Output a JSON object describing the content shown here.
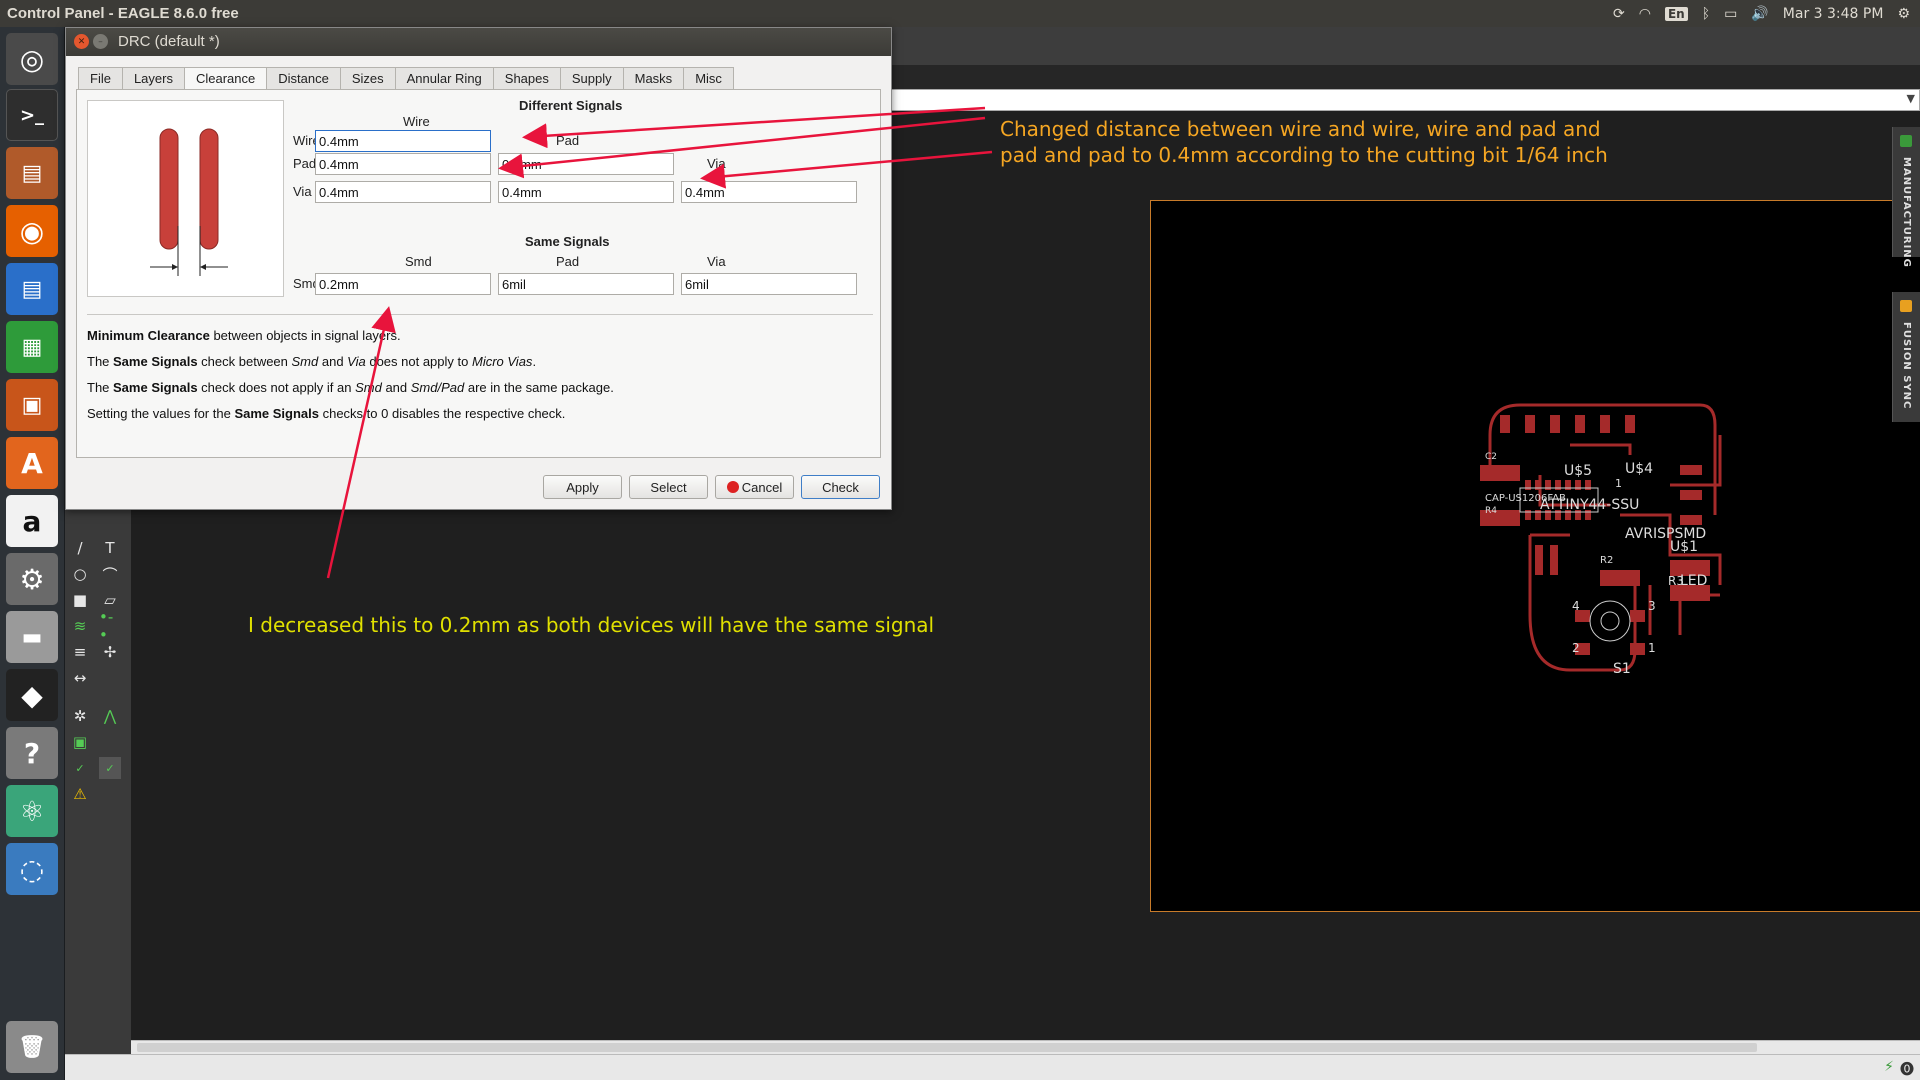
{
  "topbar": {
    "title": "Control Panel - EAGLE 8.6.0 free",
    "language": "En",
    "datetime": "Mar 3  3:48 PM"
  },
  "launcher": {
    "items": [
      "ubuntu-dash-icon",
      "terminal-icon",
      "files-icon",
      "firefox-icon",
      "writer-icon",
      "calc-icon",
      "impress-icon",
      "software-center-icon",
      "amazon-icon",
      "system-settings-icon",
      "disk-icon",
      "inkscape-icon",
      "help-icon",
      "atom-icon",
      "fusion-icon",
      "trash-icon"
    ]
  },
  "dialog": {
    "title": "DRC (default *)",
    "tabs": [
      "File",
      "Layers",
      "Clearance",
      "Distance",
      "Sizes",
      "Annular Ring",
      "Shapes",
      "Supply",
      "Masks",
      "Misc"
    ],
    "active_tab": "Clearance",
    "different_signals": {
      "title": "Different Signals",
      "col_wire": "Wire",
      "col_pad": "Pad",
      "col_via": "Via",
      "row_wire": "Wire",
      "row_pad": "Pad",
      "row_via": "Via",
      "wire_wire": "0.4mm",
      "pad_wire": "0.4mm",
      "pad_pad": "0.4mm",
      "via_wire": "0.4mm",
      "via_pad": "0.4mm",
      "via_via": "0.4mm"
    },
    "same_signals": {
      "title": "Same Signals",
      "col_smd": "Smd",
      "col_pad": "Pad",
      "col_via": "Via",
      "row_smd": "Smd",
      "smd_smd": "0.2mm",
      "smd_pad": "6mil",
      "smd_via": "6mil"
    },
    "descriptions": {
      "line1_bold": "Minimum Clearance",
      "line1_rest": " between objects in signal layers.",
      "line2_a": "The ",
      "line2_b": "Same Signals",
      "line2_c": " check between ",
      "line2_d": "Smd",
      "line2_e": " and ",
      "line2_f": "Via",
      "line2_g": " does not apply to ",
      "line2_h": "Micro Vias",
      "line2_i": ".",
      "line3_a": "The ",
      "line3_b": "Same Signals",
      "line3_c": " check does not apply if an ",
      "line3_d": "Smd",
      "line3_e": " and ",
      "line3_f": "Smd/Pad",
      "line3_g": " are in the same package.",
      "line4_a": "Setting the values for the ",
      "line4_b": "Same Signals",
      "line4_c": " checks to 0 disables the respective check."
    },
    "buttons": {
      "apply": "Apply",
      "select": "Select",
      "cancel": "Cancel",
      "check": "Check"
    }
  },
  "side_tabs": {
    "manufacturing": "MANUFACTURING",
    "fusion_sync": "FUSION SYNC"
  },
  "annotations": {
    "top_line1": "Changed distance between wire and wire, wire and pad and",
    "top_line2": "pad and pad to 0.4mm according to the cutting bit 1/64 inch",
    "bottom": "I decreased this to 0.2mm as both devices will have the same signal"
  },
  "pcb_labels": {
    "us5": "U$5",
    "us4": "U$4",
    "c2": "C2",
    "cap": "CAP-US1206FAB",
    "r4": "R4",
    "attiny": "ATTINY44-SSU",
    "avr": "AVRISPSMD",
    "us1": "U$1",
    "r2": "R2",
    "r3": "R3",
    "led": "LED",
    "s1": "S1",
    "pin4": "4",
    "pin3": "3",
    "pin2": "2",
    "pin1": "1",
    "num1": "1"
  },
  "colors": {
    "annotation_orange": "#f5a623",
    "annotation_yellow": "#e0e000",
    "arrow_red": "#e8143c",
    "pcb_copper": "#a52a2a",
    "board_outline": "#c87b2a"
  }
}
